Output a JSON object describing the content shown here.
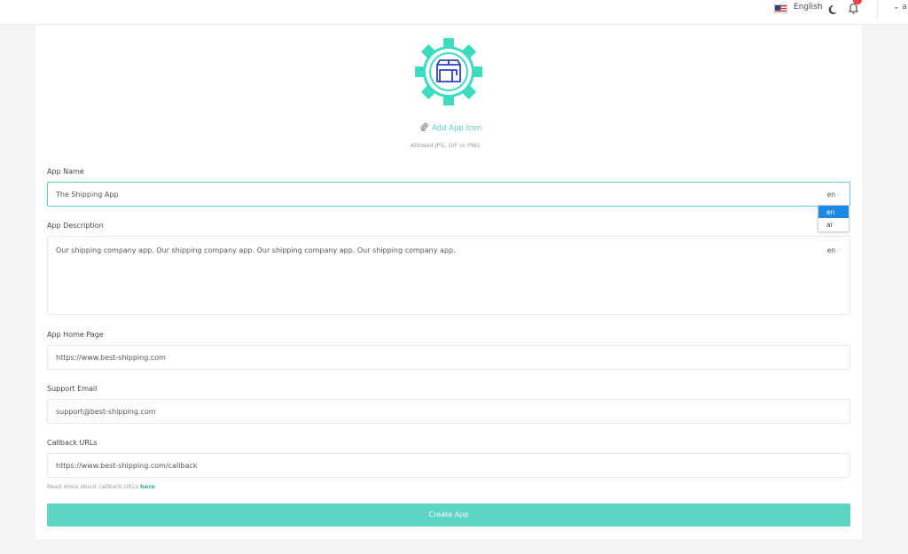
{
  "topbar": {
    "language": "English",
    "account_initial": "a",
    "icons": [
      "us-flag-icon",
      "moon-icon",
      "bell-icon",
      "chevron-down-icon"
    ]
  },
  "icon_upload": {
    "add_label": "Add App Icon",
    "allowed_types": "Allowed JPG, GIF or PNG."
  },
  "form": {
    "app_name": {
      "label": "App Name",
      "value": "The Shipping App",
      "locale": "en"
    },
    "app_description": {
      "label": "App Description",
      "value": "Our shipping company app. Our shipping company app. Our shipping company app. Our shipping company app.",
      "locale": "en"
    },
    "home_page": {
      "label": "App Home Page",
      "value": "https://www.best-shipping.com"
    },
    "support_email": {
      "label": "Support Email",
      "value": "support@best-shipping.com"
    },
    "callback_urls": {
      "label": "Callback URLs",
      "value": "https://www.best-shipping.com/callback"
    },
    "helper_text": "Read more about callback URLs",
    "helper_link": "here",
    "submit_label": "Create App"
  },
  "locale_dropdown": {
    "options": [
      "en",
      "ar"
    ],
    "selected": "en"
  },
  "colors": {
    "accent": "#5dd5c4",
    "accent_dark": "#2bb5a4",
    "icon_gear": "#3ddbbf",
    "icon_box": "#2e3fc4",
    "dropdown_selected": "#1e88e5"
  }
}
